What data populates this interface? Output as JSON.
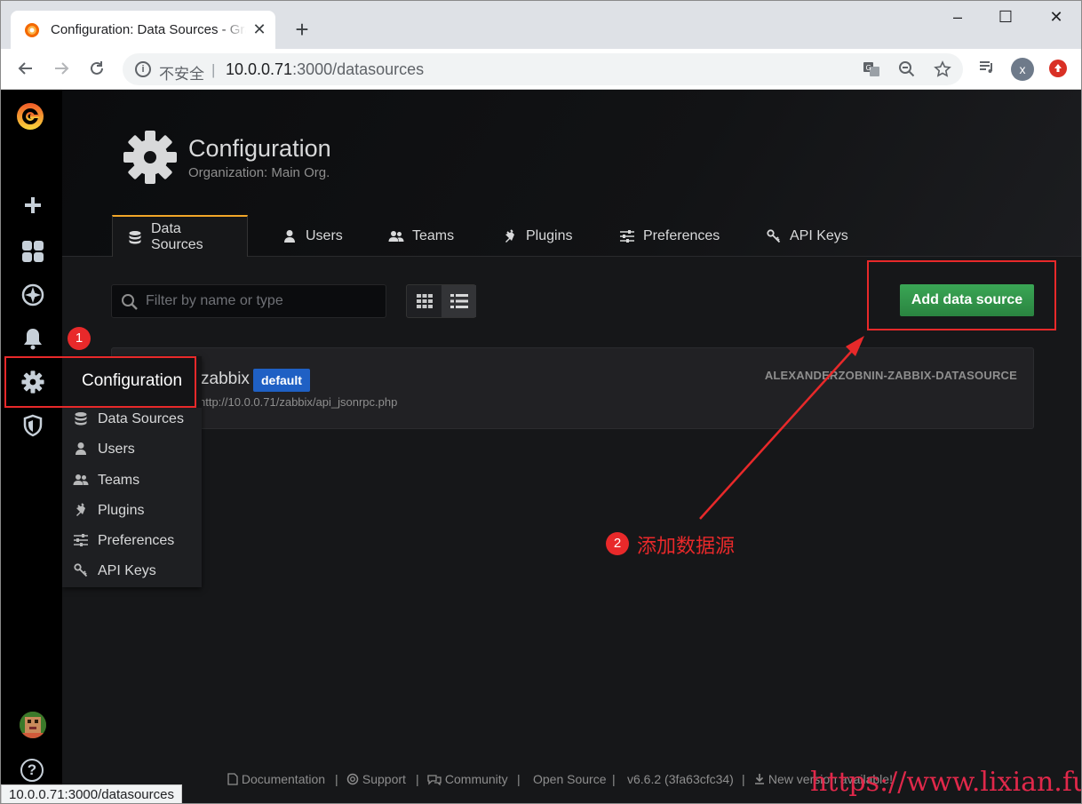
{
  "browser": {
    "tab_title": "Configuration: Data Sources - Grafana",
    "close_glyph": "✕",
    "new_tab_glyph": "+",
    "insecure_label": "不安全",
    "separator": "|",
    "url_host": "10.0.0.71",
    "url_rest": ":3000/datasources",
    "profile_initial": "x",
    "window_controls": [
      "–",
      "☐",
      "✕"
    ]
  },
  "header": {
    "title": "Configuration",
    "subtitle": "Organization: Main Org."
  },
  "tabs": [
    {
      "label": "Data Sources",
      "icon": "database-icon",
      "active": true
    },
    {
      "label": "Users",
      "icon": "user-icon",
      "active": false
    },
    {
      "label": "Teams",
      "icon": "users-icon",
      "active": false
    },
    {
      "label": "Plugins",
      "icon": "plug-icon",
      "active": false
    },
    {
      "label": "Preferences",
      "icon": "sliders-icon",
      "active": false
    },
    {
      "label": "API Keys",
      "icon": "key-icon",
      "active": false
    }
  ],
  "search": {
    "placeholder": "Filter by name or type",
    "value": ""
  },
  "add_button_label": "Add data source",
  "datasource": {
    "name": "zabbix",
    "badge": "default",
    "url": "http://10.0.0.71/zabbix/api_jsonrpc.php",
    "type": "ALEXANDERZOBNIN-ZABBIX-DATASOURCE"
  },
  "dropdown": {
    "header": "Configuration",
    "items": [
      "Data Sources",
      "Users",
      "Teams",
      "Plugins",
      "Preferences",
      "API Keys"
    ]
  },
  "annotations": {
    "num1": "1",
    "num2": "2",
    "text2": "添加数据源",
    "color": "#e8292a"
  },
  "footer": {
    "documentation": "Documentation",
    "support": "Support",
    "community": "Community",
    "open_source": "Open Source",
    "version": "v6.6.2 (3fa63cfc34)",
    "new_version": "New version available!",
    "separator": "|"
  },
  "watermark": "https://www.lixian.fun",
  "status_url": "10.0.0.71:3000/datasources",
  "colors": {
    "accent": "#f2a628",
    "add_button": "#299c46",
    "badge": "#1f60c4",
    "background": "#161719"
  }
}
